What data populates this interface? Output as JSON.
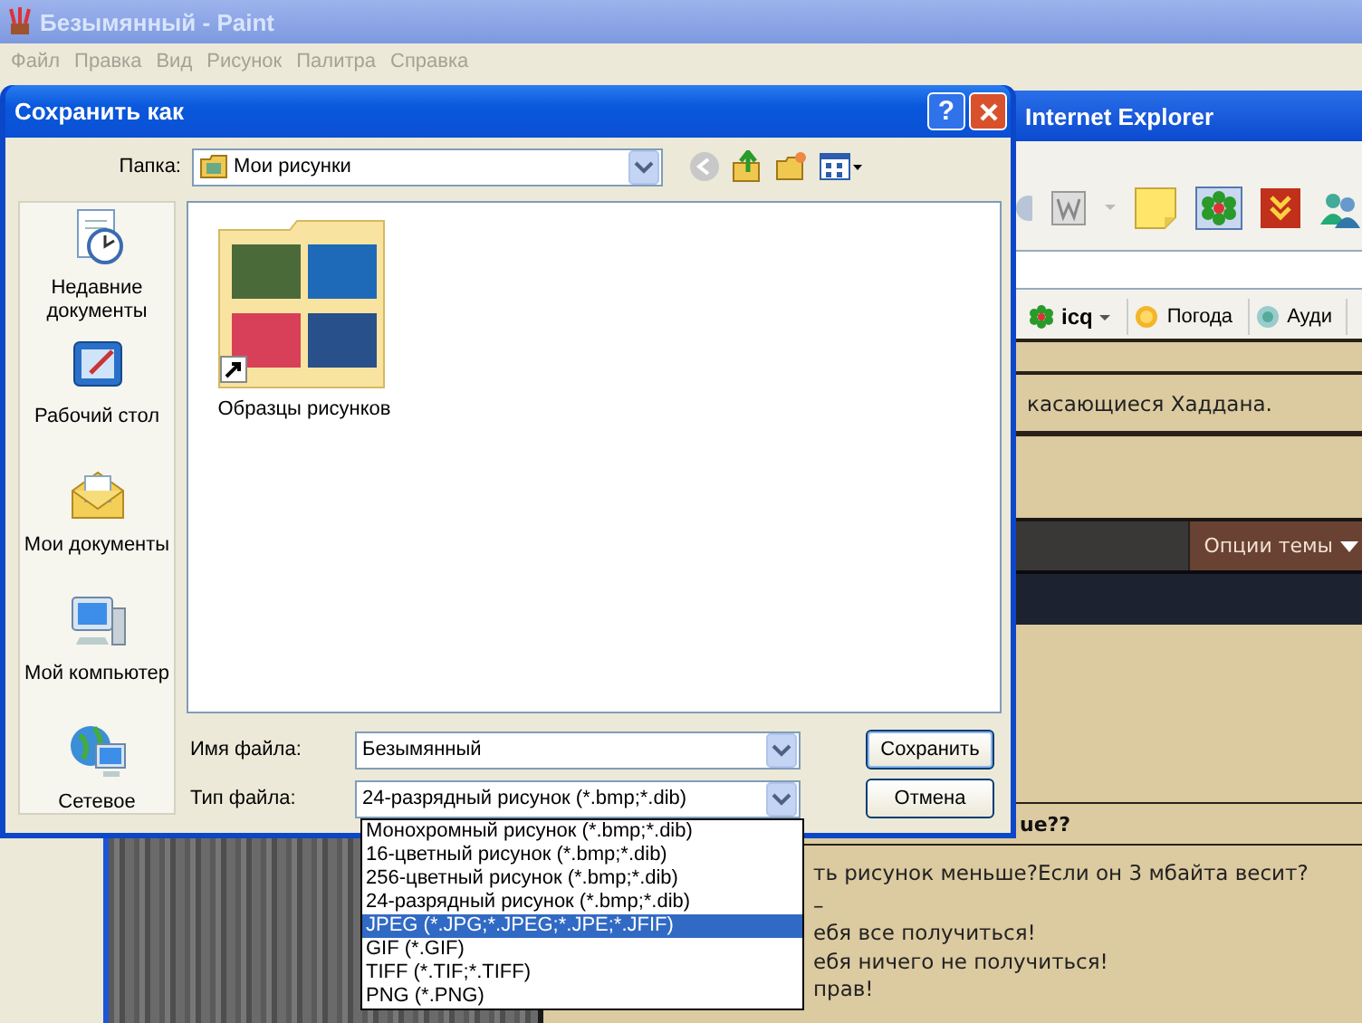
{
  "paint_window": {
    "title": "Безымянный - Paint",
    "menu": [
      {
        "label": "Файл",
        "disabled": true
      },
      {
        "label": "Правка",
        "disabled": true
      },
      {
        "label": "Вид",
        "disabled": true
      },
      {
        "label": "Рисунок",
        "disabled": true
      },
      {
        "label": "Палитра",
        "disabled": true
      },
      {
        "label": "Справка",
        "disabled": true
      }
    ]
  },
  "browser_window": {
    "title": "Internet Explorer",
    "links_bar": [
      "icq",
      "Погода",
      "Ауди"
    ],
    "page": {
      "intro_text": "касающиеся Хаддана.",
      "thread_options_button": "Опции темы",
      "post_title": "ue??",
      "post_lines": [
        "ть рисунок меньше?Если он 3 мбайта весит?",
        "–",
        "ебя все получиться!",
        "ебя ничего не получиться!",
        "прав!"
      ]
    }
  },
  "dialog": {
    "title": "Сохранить как",
    "help_button": "?",
    "folder_label": "Папка:",
    "folder_value": "Мои рисунки",
    "places": [
      "Недавние документы",
      "Рабочий стол",
      "Мои документы",
      "Мой компьютер",
      "Сетевое"
    ],
    "files": [
      "Образцы рисунков"
    ],
    "file_name_label": "Имя файла:",
    "file_name": "Безымянный",
    "file_type_label": "Тип файла:",
    "file_type": "24-разрядный рисунок (*.bmp;*.dib)",
    "buttons": [
      "Сохранить",
      "Отмена"
    ],
    "file_type_options": [
      {
        "label": "Монохромный рисунок (*.bmp;*.dib)",
        "selected": false
      },
      {
        "label": "16-цветный рисунок (*.bmp;*.dib)",
        "selected": false
      },
      {
        "label": "256-цветный рисунок (*.bmp;*.dib)",
        "selected": false
      },
      {
        "label": "24-разрядный рисунок (*.bmp;*.dib)",
        "selected": false
      },
      {
        "label": "JPEG (*.JPG;*.JPEG;*.JPE;*.JFIF)",
        "selected": true
      },
      {
        "label": "GIF (*.GIF)",
        "selected": false
      },
      {
        "label": "TIFF (*.TIF;*.TIFF)",
        "selected": false
      },
      {
        "label": "PNG (*.PNG)",
        "selected": false
      }
    ]
  }
}
